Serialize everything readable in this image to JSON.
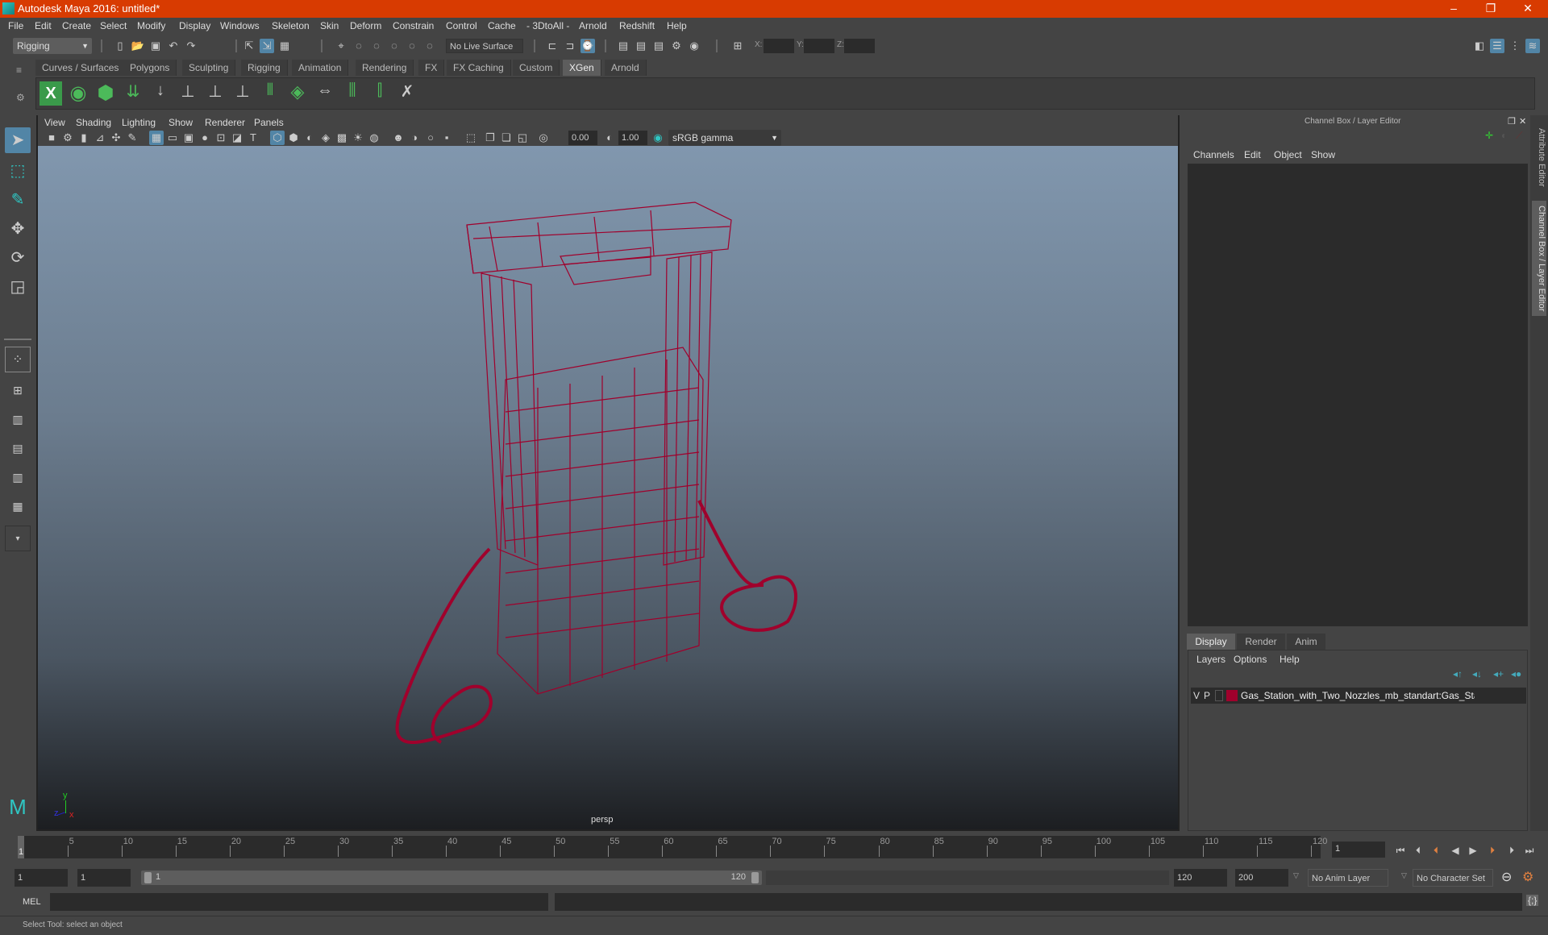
{
  "window": {
    "title": "Autodesk Maya 2016: untitled*",
    "controls": {
      "minimize": "–",
      "restore": "❐",
      "close": "✕"
    }
  },
  "menubar": [
    "File",
    "Edit",
    "Create",
    "Select",
    "Modify",
    "Display",
    "Windows",
    "Skeleton",
    "Skin",
    "Deform",
    "Constrain",
    "Control",
    "Cache",
    "- 3DtoAll -",
    "Arnold",
    "Redshift",
    "Help"
  ],
  "toolbar": {
    "menuset": "Rigging",
    "live_surface": "No Live Surface",
    "coord_labels": {
      "x": "X:",
      "y": "Y:",
      "z": "Z:"
    },
    "coord_values": {
      "x": "",
      "y": "",
      "z": ""
    }
  },
  "shelf": {
    "tabs": [
      "Curves / Surfaces",
      "Polygons",
      "Sculpting",
      "Rigging",
      "Animation",
      "Rendering",
      "FX",
      "FX Caching",
      "Custom",
      "XGen",
      "Arnold"
    ],
    "active_tab": "XGen",
    "icons": [
      "xgen-editor-icon",
      "xgen-preview-icon",
      "xgen-clear-preview-icon",
      "xgen-add-guides-icon",
      "xgen-move-guide-icon",
      "xgen-add-guide-icon",
      "xgen-sculpt-guide-icon",
      "xgen-lock-guide-icon",
      "xgen-guides-icon",
      "xgen-patches-icon",
      "xgen-flip-icon",
      "xgen-select-guide-icon",
      "xgen-guide-region-icon",
      "xgen-delete-guide-icon"
    ]
  },
  "viewport": {
    "menu": [
      "View",
      "Shading",
      "Lighting",
      "Show",
      "Renderer",
      "Panels"
    ],
    "exposure": "0.00",
    "gamma": "1.00",
    "colorspace": "sRGB gamma",
    "camera_label": "persp",
    "axis": {
      "x": "x",
      "y": "y",
      "z": "z"
    },
    "wire_color": "#a0002c",
    "bg_top": "#8197ae",
    "bg_bottom": "#1c1e21"
  },
  "channel_box": {
    "title": "Channel Box / Layer Editor",
    "menu": [
      "Channels",
      "Edit",
      "Object",
      "Show"
    ]
  },
  "layer_editor": {
    "tabs": [
      "Display",
      "Render",
      "Anim"
    ],
    "active_tab": "Display",
    "menu": [
      "Layers",
      "Options",
      "Help"
    ],
    "layers": [
      {
        "v": "V",
        "p": "P",
        "color": "#a0002c",
        "name": "Gas_Station_with_Two_Nozzles_mb_standart:Gas_Station"
      }
    ]
  },
  "side_tabs": [
    "Attribute Editor",
    "Channel Box / Layer Editor"
  ],
  "timeline": {
    "start_marker": "1",
    "ticks": [
      "5",
      "10",
      "15",
      "20",
      "25",
      "30",
      "35",
      "40",
      "45",
      "50",
      "55",
      "60",
      "65",
      "70",
      "75",
      "80",
      "85",
      "90",
      "95",
      "100",
      "105",
      "110",
      "115",
      "120"
    ],
    "current_frame": "1"
  },
  "range": {
    "start": "1",
    "playback_start": "1",
    "slider_start": "1",
    "slider_end": "120",
    "playback_end": "120",
    "end": "200",
    "anim_layer": "No Anim Layer",
    "character_set": "No Character Set"
  },
  "command": {
    "mode": "MEL",
    "input": "",
    "output": ""
  },
  "help_line": "Select Tool: select an object"
}
